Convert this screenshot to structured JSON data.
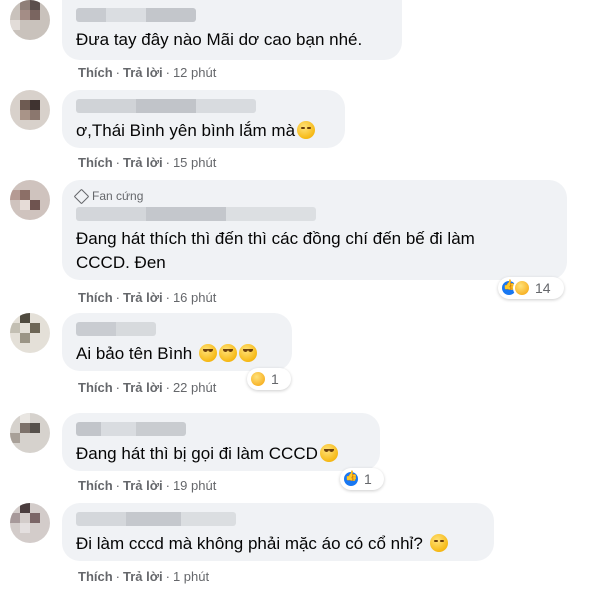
{
  "comments": [
    {
      "text": "Đưa tay đây nào Mãi dơ cao bạn nhé.",
      "like": "Thích",
      "reply": "Trả lời",
      "time": "12 phút"
    },
    {
      "text": "ơ,Thái Bình yên bình lắm mà",
      "like": "Thích",
      "reply": "Trả lời",
      "time": "15 phút"
    },
    {
      "badge": "Fan cứng",
      "text_line1": "Đang hát thích thì đến thì các đồng chí đến bế đi làm",
      "text_line2": "CCCD. Đen",
      "like": "Thích",
      "reply": "Trả lời",
      "time": "16 phút",
      "reaction_count": "14"
    },
    {
      "text": "Ai bảo tên Bình",
      "like": "Thích",
      "reply": "Trả lời",
      "time": "22 phút",
      "reaction_count": "1"
    },
    {
      "text": "Đang hát thì bị gọi đi làm CCCD",
      "like": "Thích",
      "reply": "Trả lời",
      "time": "19 phút",
      "reaction_count": "1"
    },
    {
      "text": "Đi làm cccd mà không phải mặc áo có cổ nhỉ?",
      "like": "Thích",
      "reply": "Trả lời",
      "time": "1 phút"
    }
  ],
  "separator": "·",
  "colors": {
    "bubble": "#f0f2f5",
    "meta": "#65676b",
    "like_blue": "#1877f2"
  }
}
